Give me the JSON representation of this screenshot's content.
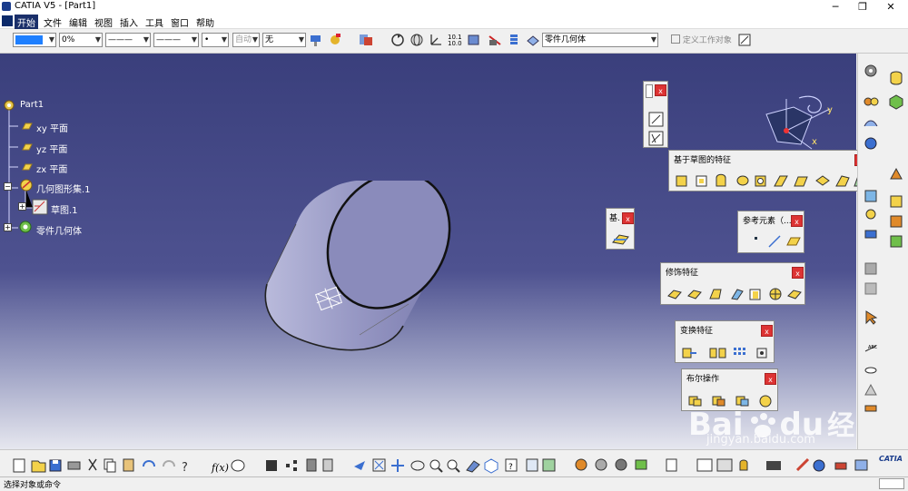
{
  "window": {
    "title": "CATIA V5 - [Part1]",
    "minimize": "─",
    "maximize": "❐",
    "close": "✕"
  },
  "menu": {
    "items": [
      "开始",
      "文件",
      "编辑",
      "视图",
      "插入",
      "工具",
      "窗口",
      "帮助"
    ]
  },
  "toolbar": {
    "transparency": "0%",
    "line_type": "———",
    "line_weight": "———",
    "point": "•",
    "auto": "自动",
    "layer": "无",
    "geometry": "零件几何体",
    "define_work_object": "定义工作对象"
  },
  "tree": {
    "root": "Part1",
    "xy": "xy 平面",
    "yz": "yz 平面",
    "zx": "zx 平面",
    "geoset": "几何图形集.1",
    "sketch": "草图.1",
    "body": "零件几何体"
  },
  "compass": {
    "x": "x",
    "y": "y"
  },
  "panels": {
    "sketch_based": "基于草图的特征",
    "basic": "基.",
    "reference": "参考元素（...",
    "dress_up": "修饰特征",
    "transform": "变换特征",
    "boolean": "布尔操作",
    "close": "x"
  },
  "status": {
    "text": "选择对象或命令"
  },
  "watermark": {
    "brand": "Bai",
    "du": "du",
    "jingyan": "经验",
    "url": "jingyan.baidu.com"
  },
  "logo": {
    "text": "CATIA"
  },
  "colors": {
    "viewport_top": "#3a3f7c",
    "viewport_bottom": "#e6e7ef",
    "cylinder": "#9c9dc7",
    "close_red": "#d33333",
    "menu_active": "#1a2f6a"
  }
}
